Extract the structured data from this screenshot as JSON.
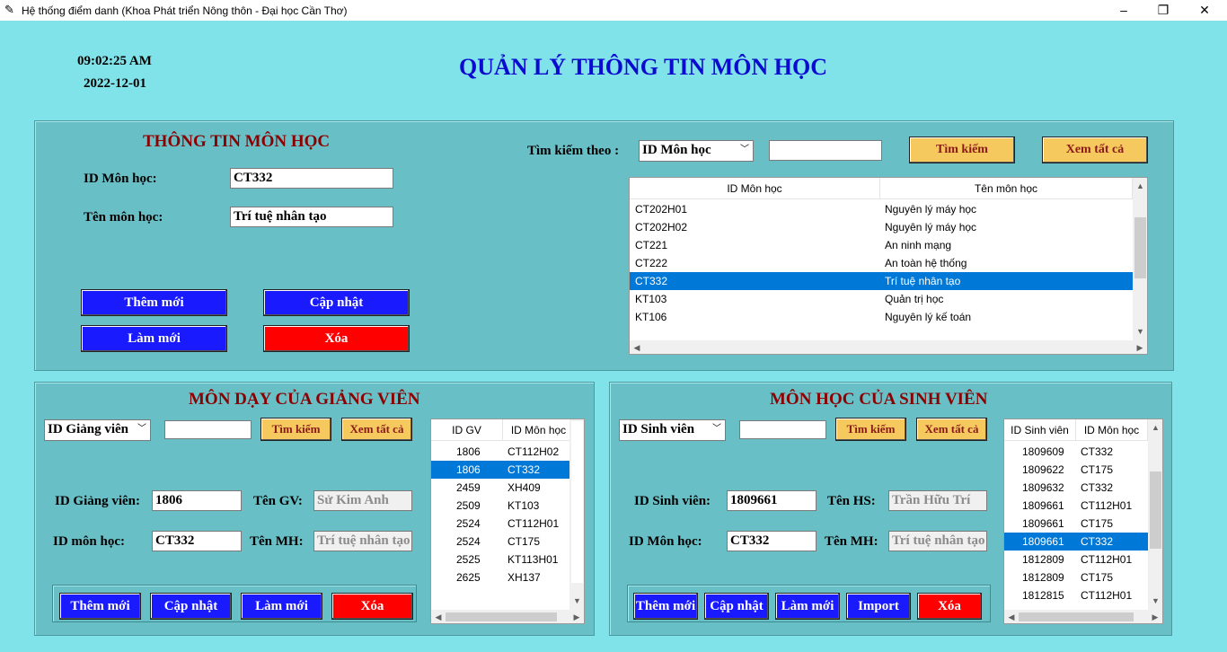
{
  "window": {
    "title": "Hệ thống điểm danh (Khoa Phát triển Nông thôn - Đại học Cần Thơ)",
    "min": "–",
    "max": "❐",
    "close": "✕",
    "icon": "feather-icon"
  },
  "clock": {
    "time": "09:02:25 AM",
    "date": "2022-12-01"
  },
  "page_title": "QUẢN LÝ THÔNG TIN MÔN HỌC",
  "course": {
    "heading": "THÔNG TIN MÔN HỌC",
    "id_label": "ID Môn học:",
    "id_value": "CT332",
    "name_label": "Tên môn học:",
    "name_value": "Trí tuệ nhân tạo",
    "add": "Thêm mới",
    "update": "Cập nhật",
    "refresh": "Làm mới",
    "delete": "Xóa",
    "search_label": "Tìm kiếm theo :",
    "search_by": "ID Môn học",
    "search_value": "",
    "search_btn": "Tìm kiếm",
    "view_all": "Xem tất cả",
    "columns": [
      "ID Môn học",
      "Tên môn học"
    ],
    "rows": [
      [
        "CT202H01",
        "Nguyên lý máy học"
      ],
      [
        "CT202H02",
        "Nguyên lý máy học"
      ],
      [
        "CT221",
        "An ninh mạng"
      ],
      [
        "CT222",
        "An toàn hệ thống"
      ],
      [
        "CT332",
        "Trí tuệ nhân tạo"
      ],
      [
        "KT103",
        "Quản trị học"
      ],
      [
        "KT106",
        "Nguyên lý kế toán"
      ]
    ],
    "selected_index": 4
  },
  "teacher": {
    "heading": "MÔN DẠY CỦA GIẢNG VIÊN",
    "search_by": "ID Giảng viên",
    "search_value": "",
    "search_btn": "Tìm kiếm",
    "view_all": "Xem tất cả",
    "id_label": "ID Giảng viên:",
    "id_value": "1806",
    "name_label": "Tên GV:",
    "name_value": "Sử Kim Anh",
    "course_label": "ID môn học:",
    "course_value": "CT332",
    "cname_label": "Tên MH:",
    "cname_value": "Trí tuệ nhân tạo",
    "add": "Thêm mới",
    "update": "Cập nhật",
    "refresh": "Làm mới",
    "delete": "Xóa",
    "columns": [
      "ID GV",
      "ID Môn học"
    ],
    "rows": [
      [
        "1806",
        "CT112H02"
      ],
      [
        "1806",
        "CT332"
      ],
      [
        "2459",
        "XH409"
      ],
      [
        "2509",
        "KT103"
      ],
      [
        "2524",
        "CT112H01"
      ],
      [
        "2524",
        "CT175"
      ],
      [
        "2525",
        "KT113H01"
      ],
      [
        "2625",
        "XH137"
      ]
    ],
    "selected_index": 1
  },
  "student": {
    "heading": "MÔN HỌC CỦA SINH VIÊN",
    "search_by": "ID Sinh viên",
    "search_value": "",
    "search_btn": "Tìm kiếm",
    "view_all": "Xem tất cả",
    "id_label": "ID Sinh viên:",
    "id_value": "1809661",
    "name_label": "Tên HS:",
    "name_value": "Trần Hữu Trí",
    "course_label": "ID Môn học:",
    "course_value": "CT332",
    "cname_label": "Tên MH:",
    "cname_value": "Trí tuệ nhân tạo",
    "add": "Thêm mới",
    "update": "Cập nhật",
    "refresh": "Làm mới",
    "import": "Import",
    "delete": "Xóa",
    "columns": [
      "ID Sinh viên",
      "ID Môn học"
    ],
    "rows": [
      [
        "1809609",
        "CT332"
      ],
      [
        "1809622",
        "CT175"
      ],
      [
        "1809632",
        "CT332"
      ],
      [
        "1809661",
        "CT112H01"
      ],
      [
        "1809661",
        "CT175"
      ],
      [
        "1809661",
        "CT332"
      ],
      [
        "1812809",
        "CT112H01"
      ],
      [
        "1812809",
        "CT175"
      ],
      [
        "1812815",
        "CT112H01"
      ]
    ],
    "selected_index": 5
  },
  "colors": {
    "bg": "#80e3ea",
    "panel": "#68bfc6",
    "title": "#0a0ad0",
    "heading": "#8b0000",
    "blue_btn": "#1a1aff",
    "red_btn": "#ff0000",
    "yellow_btn": "#f5c95e",
    "selection": "#0078d7"
  }
}
